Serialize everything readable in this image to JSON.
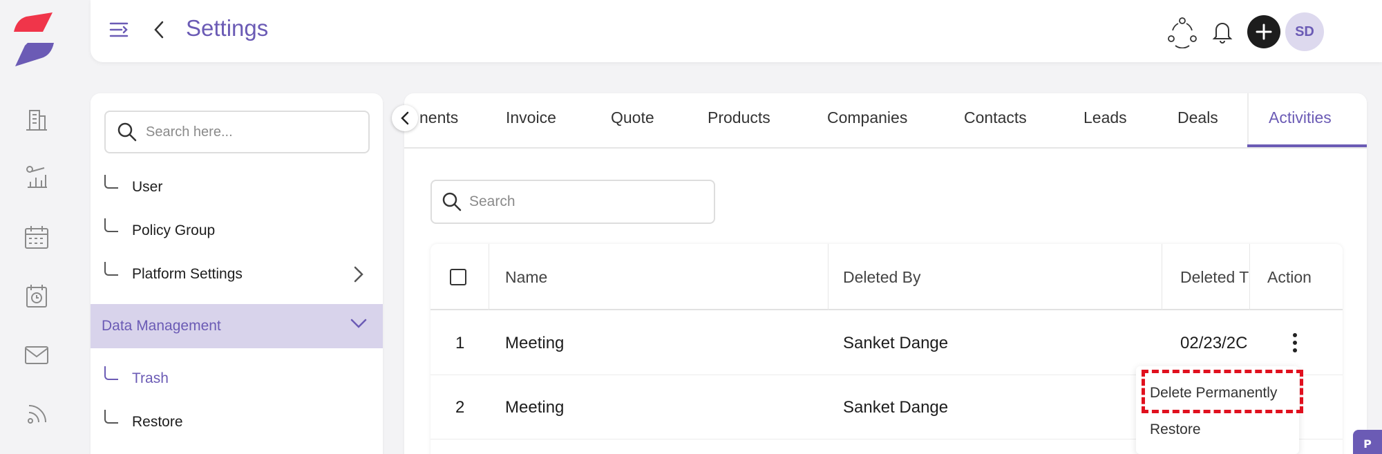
{
  "header": {
    "title": "Settings",
    "avatar_initials": "SD"
  },
  "rail": {
    "icons": [
      "building-icon",
      "analytics-icon",
      "calendar-icon",
      "clock-calendar-icon",
      "mail-icon",
      "feed-icon"
    ]
  },
  "sidebar": {
    "search_placeholder": "Search here...",
    "items": [
      {
        "label": "User"
      },
      {
        "label": "Policy Group"
      },
      {
        "label": "Platform Settings"
      }
    ],
    "group": {
      "label": "Data Management"
    },
    "sub_items": [
      {
        "label": "Trash",
        "active": true
      },
      {
        "label": "Restore"
      }
    ]
  },
  "tabs": [
    {
      "label": "nents"
    },
    {
      "label": "Invoice"
    },
    {
      "label": "Quote"
    },
    {
      "label": "Products"
    },
    {
      "label": "Companies"
    },
    {
      "label": "Contacts"
    },
    {
      "label": "Leads"
    },
    {
      "label": "Deals"
    },
    {
      "label": "Activities",
      "active": true
    }
  ],
  "main": {
    "search_placeholder": "Search"
  },
  "table": {
    "columns": [
      "Name",
      "Deleted By",
      "Deleted T",
      "Action"
    ],
    "rows": [
      {
        "index": "1",
        "name": "Meeting",
        "deleted_by": "Sanket Dange",
        "deleted_time": "02/23/2C"
      },
      {
        "index": "2",
        "name": "Meeting",
        "deleted_by": "Sanket Dange",
        "deleted_time": ""
      }
    ]
  },
  "action_menu": {
    "items": [
      "Delete Permanently",
      "Restore"
    ]
  },
  "corner_tab": {
    "label": "P"
  },
  "colors": {
    "accent": "#6b5bb5",
    "highlight": "#e0101e",
    "logo_red": "#f0354a"
  }
}
